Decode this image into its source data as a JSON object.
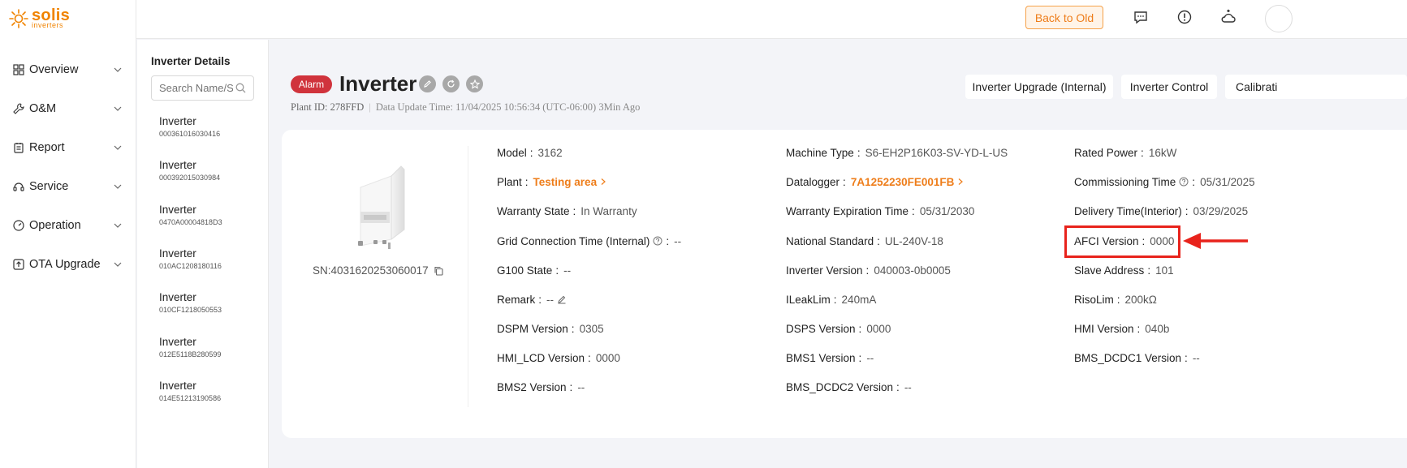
{
  "logo": {
    "brand": "solis",
    "tagline": "inverters"
  },
  "sidebar": {
    "items": [
      {
        "label": "Overview",
        "icon": "overview-icon"
      },
      {
        "label": "O&M",
        "icon": "wrench-icon"
      },
      {
        "label": "Report",
        "icon": "report-icon"
      },
      {
        "label": "Service",
        "icon": "service-icon"
      },
      {
        "label": "Operation",
        "icon": "gauge-icon"
      },
      {
        "label": "OTA Upgrade",
        "icon": "upload-icon"
      }
    ]
  },
  "topbar": {
    "back_label": "Back to Old",
    "icons": [
      "message-icon",
      "alert-icon",
      "cloud-icon"
    ]
  },
  "list": {
    "title": "Inverter Details",
    "search_placeholder": "Search Name/SN",
    "items": [
      {
        "name": "Inverter",
        "sn": "000361016030416"
      },
      {
        "name": "Inverter",
        "sn": "000392015030984"
      },
      {
        "name": "Inverter",
        "sn": "0470A00004818D3"
      },
      {
        "name": "Inverter",
        "sn": "010AC1208180116"
      },
      {
        "name": "Inverter",
        "sn": "010CF1218050553"
      },
      {
        "name": "Inverter",
        "sn": "012E5118B280599"
      },
      {
        "name": "Inverter",
        "sn": "014E51213190586"
      }
    ]
  },
  "header": {
    "status_badge": "Alarm",
    "title": "Inverter",
    "plant_id": "Plant ID: 278FFD",
    "separator": "|",
    "update_time": "Data Update Time: 11/04/2025 10:56:34 (UTC-06:00) 3Min Ago",
    "actions": [
      "Inverter Upgrade (Internal)",
      "Inverter Control",
      "Calibrati"
    ]
  },
  "device": {
    "sn": "SN:4031620253060017"
  },
  "fields": {
    "col1": [
      {
        "key": "Model",
        "value": "3162"
      },
      {
        "key": "Plant",
        "value": "Testing area",
        "link": true
      },
      {
        "key": "Warranty State",
        "value": "In Warranty"
      },
      {
        "key": "Grid Connection Time (Internal)",
        "value": "--",
        "help": true
      },
      {
        "key": "G100 State",
        "value": "--"
      },
      {
        "key": "Remark",
        "value": "--",
        "edit": true
      },
      {
        "key": "DSPM Version",
        "value": "0305"
      },
      {
        "key": "HMI_LCD Version",
        "value": "0000"
      },
      {
        "key": "BMS2 Version",
        "value": "--"
      }
    ],
    "col2": [
      {
        "key": "Machine Type",
        "value": "S6-EH2P16K03-SV-YD-L-US"
      },
      {
        "key": "Datalogger",
        "value": "7A1252230FE001FB",
        "link": true
      },
      {
        "key": "Warranty Expiration Time",
        "value": "05/31/2030"
      },
      {
        "key": "National Standard",
        "value": "UL-240V-18"
      },
      {
        "key": "Inverter Version",
        "value": "040003-0b0005"
      },
      {
        "key": "ILeakLim",
        "value": "240mA"
      },
      {
        "key": "DSPS Version",
        "value": "0000"
      },
      {
        "key": "BMS1 Version",
        "value": "--"
      },
      {
        "key": "BMS_DCDC2 Version",
        "value": "--"
      }
    ],
    "col3": [
      {
        "key": "Rated Power",
        "value": "16kW"
      },
      {
        "key": "Commissioning Time",
        "value": "05/31/2025",
        "help": true
      },
      {
        "key": "Delivery Time(Interior)",
        "value": "03/29/2025"
      },
      {
        "key": "AFCI Version",
        "value": "0000"
      },
      {
        "key": "Slave Address",
        "value": "101"
      },
      {
        "key": "RisoLim",
        "value": "200kΩ"
      },
      {
        "key": "HMI Version",
        "value": "040b"
      },
      {
        "key": "BMS_DCDC1 Version",
        "value": "--"
      }
    ]
  },
  "colors": {
    "accent": "#ee7d1a",
    "alarm": "#d0333c",
    "highlight": "#e8231c"
  }
}
